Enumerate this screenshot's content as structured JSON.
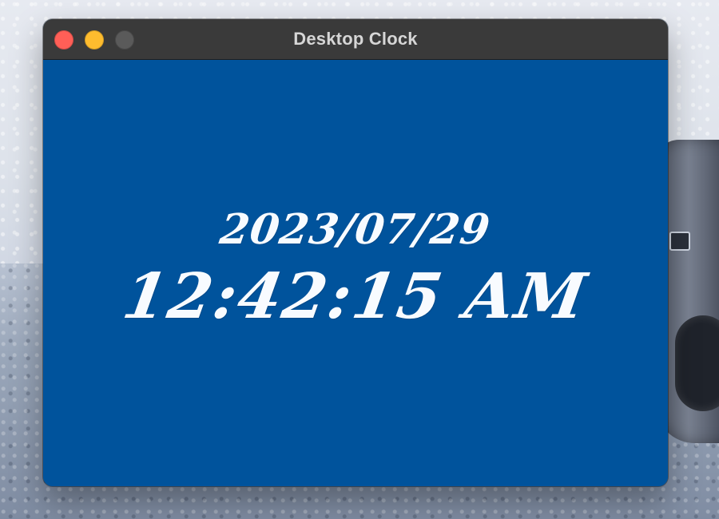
{
  "window": {
    "title": "Desktop Clock"
  },
  "controls": {
    "close": {
      "color": "#ff5f57",
      "icon": "close-icon"
    },
    "minimize": {
      "color": "#febc2e",
      "icon": "minimize-icon"
    },
    "zoom": {
      "color": "#5a5a5a",
      "icon": "zoom-icon"
    }
  },
  "clock": {
    "date": "2023/07/29",
    "time": "12:42:15 AM"
  },
  "colors": {
    "window_background": "#00539c",
    "titlebar_background": "#3a3a3a",
    "text": "#f8fbff",
    "title_text": "#d6d6d6"
  }
}
